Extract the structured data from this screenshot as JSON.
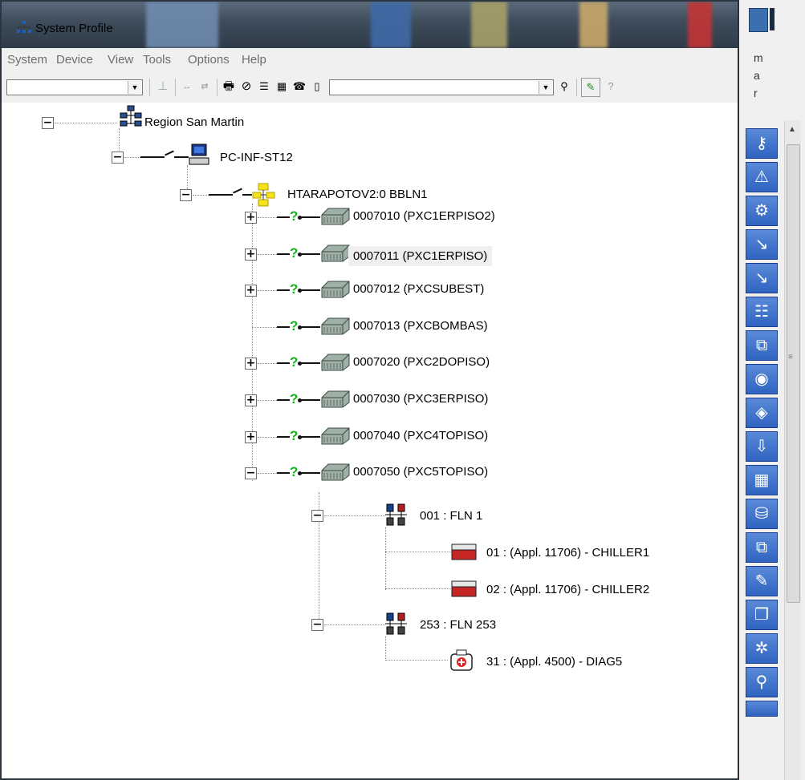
{
  "window": {
    "title": "System Profile"
  },
  "menu": [
    "System",
    "Device",
    "View",
    "Tools",
    "Options",
    "Help"
  ],
  "toolbar": {
    "combo1_value": "",
    "combo2_value": ""
  },
  "tree": {
    "root": "Region San Martin",
    "pc": "PC-INF-ST12",
    "network": "HTARAPOTOV2:0  BBLN1",
    "controllers": [
      {
        "label": "0007010 (PXC1ERPISO2)",
        "expander": "+"
      },
      {
        "label": "0007011 (PXC1ERPISO)",
        "expander": "+"
      },
      {
        "label": "0007012 (PXCSUBEST)",
        "expander": "+"
      },
      {
        "label": "0007013 (PXCBOMBAS)",
        "expander": ""
      },
      {
        "label": "0007020 (PXC2DOPISO)",
        "expander": "+"
      },
      {
        "label": "0007030 (PXC3ERPISO)",
        "expander": "+"
      },
      {
        "label": "0007040 (PXC4TOPISO)",
        "expander": "+"
      },
      {
        "label": "0007050 (PXC5TOPISO)",
        "expander": "−"
      }
    ],
    "flns": [
      {
        "label": "001 : FLN 1",
        "devices": [
          "01 : (Appl.  11706) - CHILLER1",
          "02 : (Appl.  11706) - CHILLER2"
        ]
      },
      {
        "label": "253 : FLN 253",
        "devices": [
          "31 : (Appl.  4500) - DIAG5"
        ]
      }
    ]
  },
  "right_panel": {
    "letters": [
      "m",
      "a",
      "r"
    ]
  },
  "colors": {
    "accent_blue": "#2f63c0",
    "status_green": "#18b21f"
  }
}
